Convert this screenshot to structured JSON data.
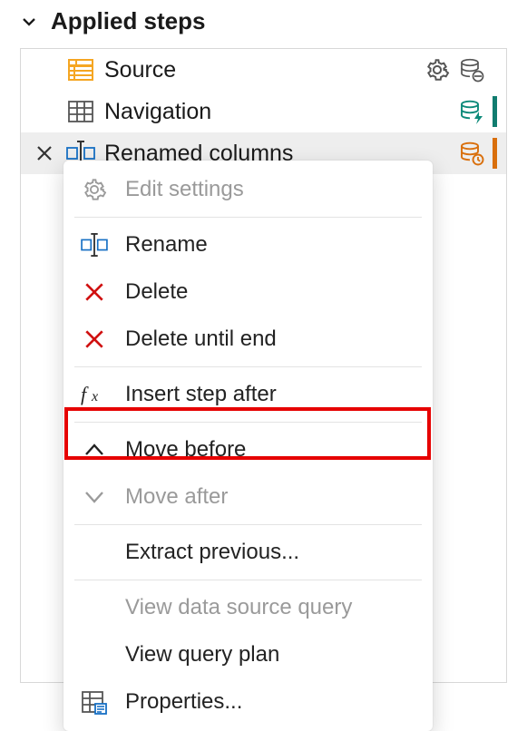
{
  "header": {
    "title": "Applied steps"
  },
  "steps": [
    {
      "label": "Source"
    },
    {
      "label": "Navigation"
    },
    {
      "label": "Renamed columns"
    }
  ],
  "menu": {
    "editSettings": "Edit settings",
    "rename": "Rename",
    "delete": "Delete",
    "deleteUntilEnd": "Delete until end",
    "insertStepAfter": "Insert step after",
    "moveBefore": "Move before",
    "moveAfter": "Move after",
    "extractPrevious": "Extract previous...",
    "viewDataSourceQuery": "View data source query",
    "viewQueryPlan": "View query plan",
    "properties": "Properties..."
  },
  "highlightedMenuItem": "moveBefore"
}
